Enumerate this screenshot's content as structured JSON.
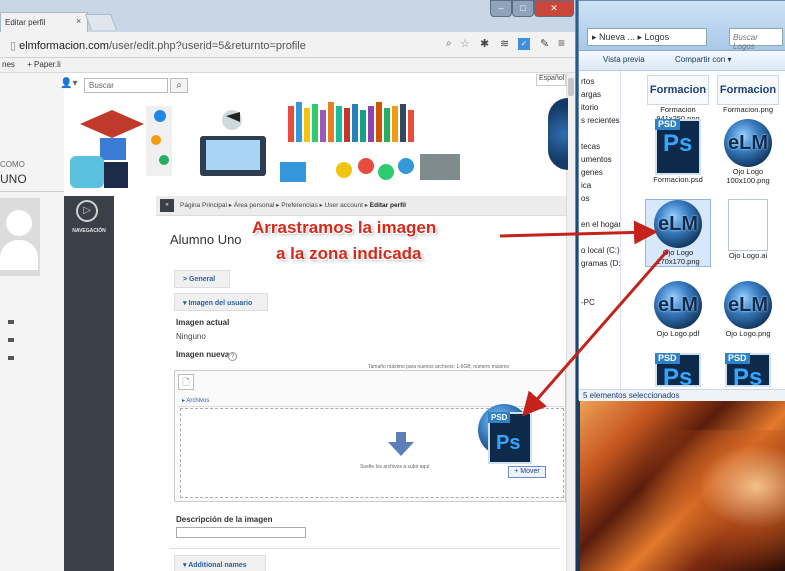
{
  "browser": {
    "tab_title": "Editar perfil",
    "tab_close": "×",
    "url_host": "elmformacion.com",
    "url_path": "/user/edit.php?userid=5&returnto=profile",
    "bookmark_label": "nes",
    "bookmark_paperli": "+ Paper.li",
    "win_min": "–",
    "win_max": "□",
    "win_close": "✕"
  },
  "site": {
    "search_placeholder": "Buscar",
    "language": "Español",
    "nav_label": "NAVEGACIÓN",
    "profile_caption": "COMO",
    "profile_name": "UNO",
    "breadcrumb": [
      "Página Principal",
      "Área personal",
      "Preferencias",
      "User account",
      "Editar perfil"
    ],
    "user_title": "Alumno Uno"
  },
  "form": {
    "general_label": "> General",
    "image_section_label": "▾ Imagen del usuario",
    "current_image_label": "Imagen actual",
    "current_image_value": "Ninguno",
    "new_image_label": "Imagen nueva",
    "max_size_text": "Tamaño máximo para nuevos archivos: 1.6GB, número máximo",
    "folder_label": "▸ Archivos",
    "drop_text": "Suelte los archivos a subir aquí",
    "move_label": "+ Mover",
    "description_label": "Descripción de la imagen",
    "additional_names_label": "▾ Additional names"
  },
  "annotation": {
    "line1": "Arrastramos la imagen",
    "line2": "a la zona indicada"
  },
  "explorer": {
    "path": "▸ Nueva ... ▸ Logos",
    "search_placeholder": "Buscar Logos",
    "toolbar_preview": "Vista previa",
    "toolbar_share": "Compartir con ▾",
    "nav_items": [
      "rtos",
      "argas",
      "itorio",
      "s recientes",
      "",
      "tecas",
      "umentos",
      "genes",
      "ica",
      "os",
      "",
      "en el hogar",
      "",
      "o local (C:)",
      "gramas (D:)",
      "",
      "",
      "-PC"
    ],
    "files": [
      {
        "name": "Formacion 941x250.png",
        "icon": "formacion-logo-icon"
      },
      {
        "name": "Formacion.png",
        "icon": "formacion-logo-icon"
      },
      {
        "name": "Formacion.psd",
        "icon": "psd-file-icon"
      },
      {
        "name": "Ojo Logo 100x100.png",
        "icon": "eye-logo-icon"
      },
      {
        "name": "Ojo Logo 170x170.png",
        "icon": "eye-logo-icon"
      },
      {
        "name": "Ojo Logo.ai",
        "icon": "blank-file-icon"
      },
      {
        "name": "Ojo Logo.pdf",
        "icon": "eye-logo-icon"
      },
      {
        "name": "Ojo Logo.png",
        "icon": "eye-logo-icon"
      }
    ],
    "logo_text": "Formacion",
    "status": "5 elementos seleccionados"
  },
  "colors": {
    "annotation_red": "#d42a1a",
    "nav_dark": "#3a3f48",
    "link_blue": "#2a5ea0"
  }
}
